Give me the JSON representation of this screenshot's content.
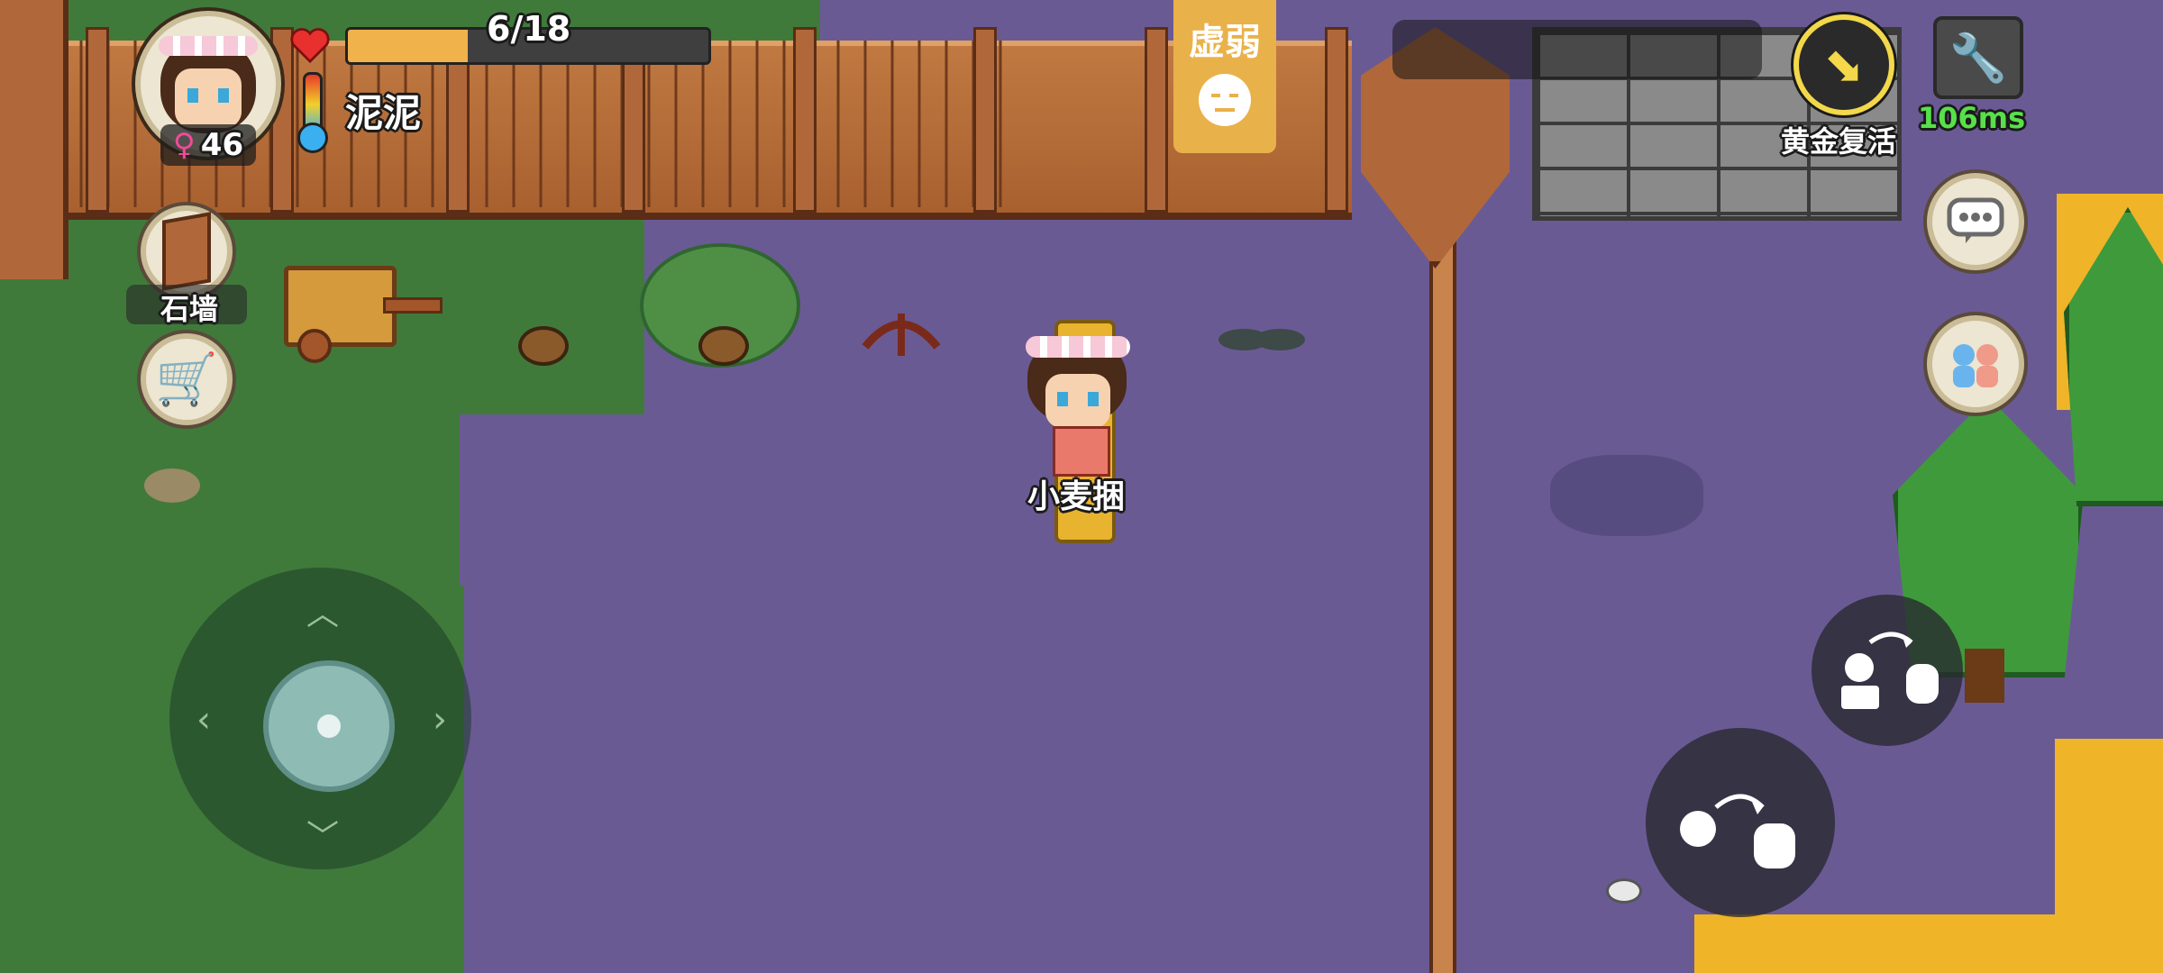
{
  "player": {
    "level": "46",
    "name": "泥泥",
    "hp_text": "6/18",
    "hp_fraction": 0.333
  },
  "status": {
    "weak_label": "虚弱"
  },
  "build": {
    "stone_wall_label": "石墙"
  },
  "item": {
    "carried_label": "小麦捆"
  },
  "revive": {
    "label": "黄金复活"
  },
  "network": {
    "ping": "106ms"
  },
  "icons": {
    "heart": "heart-icon",
    "thermometer": "thermometer-icon",
    "female": "female-icon",
    "settings": "wrench-icon",
    "chat": "chat-bubble-icon",
    "friends": "friends-icon",
    "shop": "shopping-cart-icon",
    "door": "door-icon",
    "weak": "sad-face-icon",
    "revive": "revive-arrow-icon",
    "throw": "throw-icon",
    "pickup": "pickup-hand-icon",
    "joystick": "joystick-icon"
  },
  "colors": {
    "hp_fill": "#f0b24a",
    "ping": "#58e04a",
    "weak_tag": "#e9b14a",
    "revive_ring": "#f2d84a",
    "ground": "#6a5a94",
    "grass": "#3f7a3a",
    "sand": "#f0b428"
  }
}
